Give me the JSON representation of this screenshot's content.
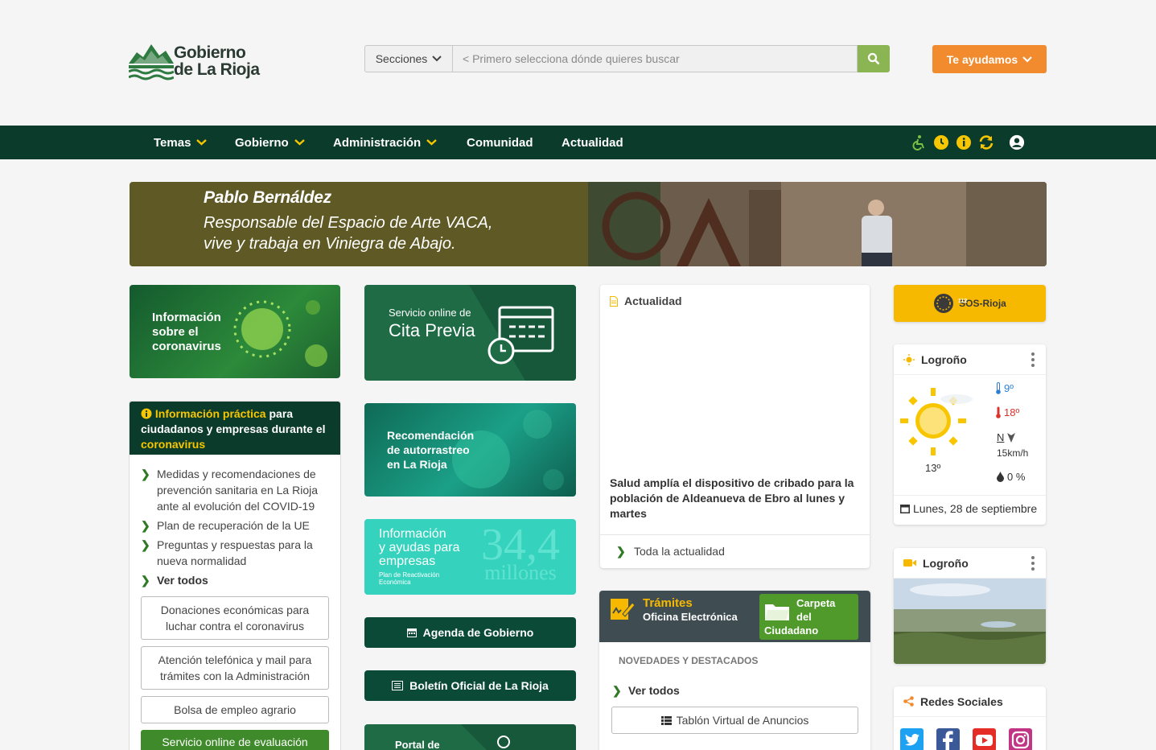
{
  "header": {
    "logo_line1": "Gobierno",
    "logo_line2": "de La Rioja",
    "sections_label": "Secciones",
    "search_placeholder": "< Primero selecciona dónde quieres buscar",
    "help_label": "Te ayudamos"
  },
  "nav": {
    "items": [
      {
        "label": "Temas",
        "dropdown": true
      },
      {
        "label": "Gobierno",
        "dropdown": true
      },
      {
        "label": "Administración",
        "dropdown": true
      },
      {
        "label": "Comunidad",
        "dropdown": false
      },
      {
        "label": "Actualidad",
        "dropdown": false
      }
    ],
    "icons": [
      "accessibility-icon",
      "clock-icon",
      "info-icon",
      "refresh-icon",
      "user-icon"
    ]
  },
  "banner": {
    "name": "Pablo Bernáldez",
    "desc_line1": "Responsable del Espacio de Arte VACA,",
    "desc_line2": "vive y trabaja en Viniegra de Abajo."
  },
  "tiles": {
    "corona_line1": "Información",
    "corona_line2": "sobre el",
    "corona_line3": "coronavirus",
    "cita_line1": "Servicio online de",
    "cita_line2": "Cita Previa",
    "rastreo_line1": "Recomendación",
    "rastreo_line2": "de autorrastreo",
    "rastreo_line3": "en La Rioja",
    "ayudas_line1": "Información",
    "ayudas_line2": "y ayudas para",
    "ayudas_line3": "empresas",
    "ayudas_sub1": "Plan de Reactivación",
    "ayudas_sub2": "Económica",
    "ayudas_big1": "34,4",
    "ayudas_big2": "millones",
    "portal_label": "Portal de"
  },
  "info_box": {
    "head_hl1": "Información práctica",
    "head_mid": " para ciudadanos y empresas durante el ",
    "head_hl2": "coronavirus",
    "links": [
      "Medidas y recomendaciones de prevención sanitaria en La Rioja ante al evolución del COVID-19",
      "Plan de recuperación de la UE",
      "Preguntas y respuestas para la nueva normalidad"
    ],
    "see_all": "Ver todos",
    "buttons": [
      "Donaciones económicas para luchar contra el coronavirus",
      "Atención telefónica y mail para trámites con la Administración",
      "Bolsa de empleo agrario"
    ],
    "green_button": "Servicio online de evaluación"
  },
  "dark_buttons": {
    "agenda": "Agenda de Gobierno",
    "boletin": "Boletín Oficial de La Rioja"
  },
  "actualidad": {
    "title": "Actualidad",
    "headline": "Salud amplía el dispositivo de cribado para la población de Aldeanueva de Ebro al lunes y martes",
    "footer": "Toda la actualidad"
  },
  "tramites": {
    "title": "Trámites",
    "subtitle": "Oficina Electrónica",
    "carpeta_line1": "Carpeta",
    "carpeta_line2": "del",
    "carpeta_line3": "Ciudadano",
    "section": "NOVEDADES Y DESTACADOS",
    "see_all": "Ver todos",
    "tablon": "Tablón Virtual de Anuncios"
  },
  "sidebar": {
    "sos": "SOS-Rioja",
    "sos_badge": "112",
    "weather": {
      "city": "Logroño",
      "temp_min": "9º",
      "temp_max": "18º",
      "wind_dir": "N",
      "wind_speed": "15km/h",
      "current": "13º",
      "rain": "0 %",
      "date": "Lunes, 28 de septiembre"
    },
    "webcam_city": "Logroño",
    "social_title": "Redes Sociales",
    "social_icons": [
      "twitter-icon",
      "facebook-icon",
      "youtube-icon",
      "instagram-icon"
    ]
  },
  "colors": {
    "nav_bg": "#0b3b2a",
    "accent_orange": "#f28b2d",
    "search_green": "#8bb553",
    "sos_yellow": "#f7b900",
    "banner_olive": "#5f5a25"
  }
}
